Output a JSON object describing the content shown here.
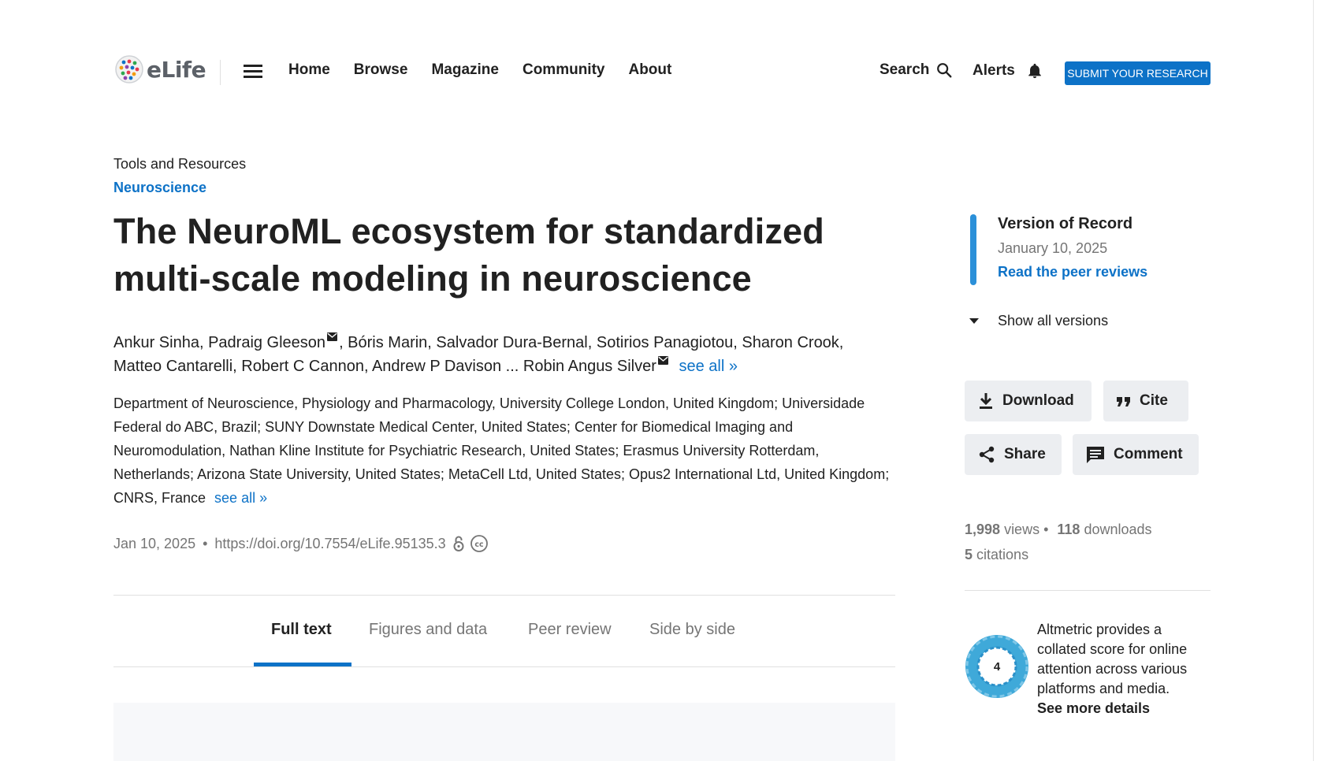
{
  "header": {
    "logo_text": "eLife",
    "nav": [
      "Home",
      "Browse",
      "Magazine",
      "Community",
      "About"
    ],
    "search_label": "Search",
    "alerts_label": "Alerts",
    "submit_label": "SUBMIT YOUR RESEARCH"
  },
  "article": {
    "type": "Tools and Resources",
    "subject": "Neuroscience",
    "title": "The NeuroML ecosystem for standardized multi-scale modeling in neuroscience",
    "authors_line1_a": "Ankur Sinha, Padraig Gleeson",
    "authors_line1_b": ", Bóris Marin, Salvador Dura-Bernal, Sotirios Panagiotou, Sharon Crook,",
    "authors_line2": "Matteo Cantarelli, Robert C Cannon, Andrew P Davison ... Robin Angus Silver",
    "authors_see_all": "see all »",
    "affiliations": "Department of Neuroscience, Physiology and Pharmacology, University College London, United Kingdom; Universidade Federal do ABC, Brazil; SUNY Downstate Medical Center, United States; Center for Biomedical Imaging and Neuromodulation, Nathan Kline Institute for Psychiatric Research, United States; Erasmus University Rotterdam, Netherlands; Arizona State University, United States; MetaCell Ltd, United States; Opus2 International Ltd, United Kingdom; CNRS, France",
    "affiliations_see_all": "see all »",
    "date": "Jan 10, 2025",
    "separator": "•",
    "doi": "https://doi.org/10.7554/eLife.95135.3"
  },
  "tabs": {
    "full_text": "Full text",
    "figures": "Figures and data",
    "peer_review": "Peer review",
    "side_by_side": "Side by side",
    "active": "Full text"
  },
  "sidebar": {
    "version_title": "Version of Record",
    "version_date": "January 10, 2025",
    "peer_reviews_link": "Read the peer reviews",
    "show_versions": "Show all versions",
    "download": "Download",
    "cite": "Cite",
    "share": "Share",
    "comment": "Comment",
    "views_count": "1,998",
    "views_label": "views •",
    "downloads_count": "118",
    "downloads_label": "downloads",
    "citations_count": "5",
    "citations_label": "citations",
    "altmetric_score": "4",
    "altmetric_text": "Altmetric provides a collated score for online attention across various platforms and media.",
    "altmetric_link": "See more details"
  },
  "colors": {
    "accent": "#0d72c7",
    "version_bar": "#2b90d9",
    "muted_text": "#757575",
    "button_bg": "#eceef1"
  }
}
